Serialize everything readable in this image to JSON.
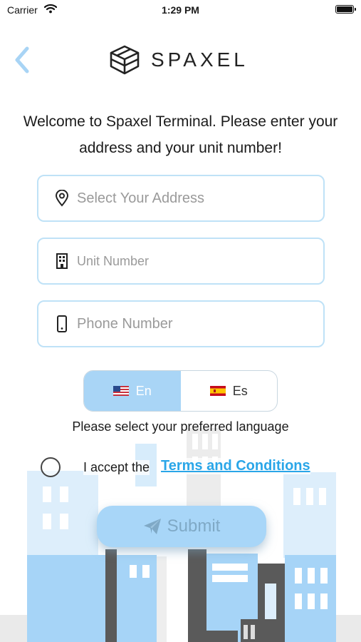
{
  "status_bar": {
    "carrier": "Carrier",
    "time": "1:29 PM"
  },
  "header": {
    "brand": "SPAXEL",
    "back_icon": "chevron-left-icon"
  },
  "welcome": "Welcome to Spaxel Terminal. Please enter your address and your unit number!",
  "form": {
    "address_placeholder": "Select Your Address",
    "unit_placeholder": "Unit Number",
    "phone_placeholder": "Phone Number"
  },
  "language": {
    "options": [
      {
        "label": "En",
        "flag": "us-flag-icon",
        "selected": true
      },
      {
        "label": "Es",
        "flag": "es-flag-icon",
        "selected": false
      }
    ],
    "hint": "Please select your preferred language"
  },
  "terms": {
    "prefix": "I accept the",
    "link": "Terms and Conditions"
  },
  "submit_label": "Submit",
  "colors": {
    "accent": "#2aa6e8",
    "field_border": "#bfe2f7",
    "toggle_active": "#a9d5f6",
    "submit_bg": "#a8d6f8"
  }
}
